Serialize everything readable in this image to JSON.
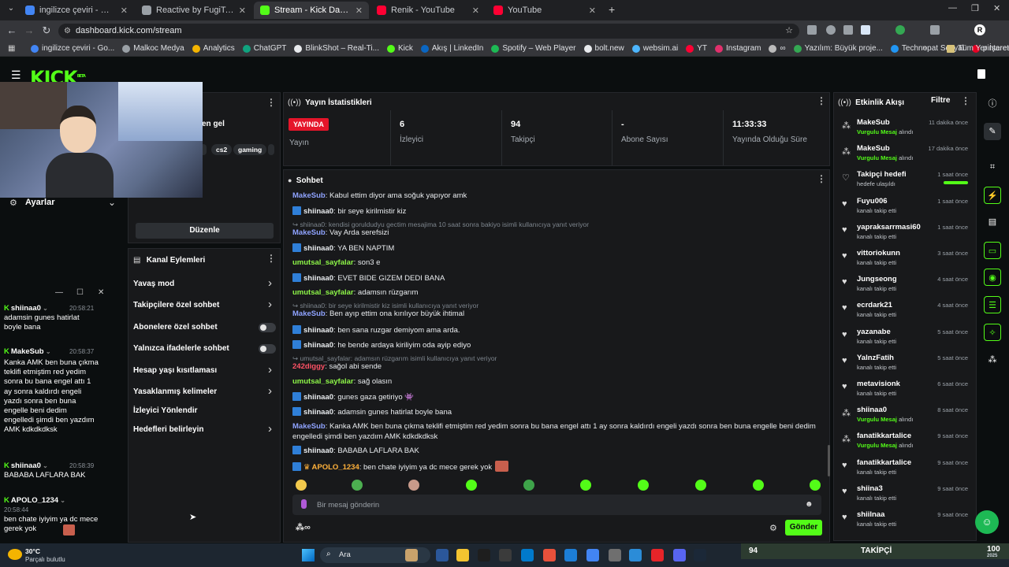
{
  "browser": {
    "tabs": [
      {
        "label": "ingilizce çeviri - Google'da Ara",
        "color": "#4285f4",
        "active": false
      },
      {
        "label": "Reactive by FugiTech",
        "color": "#9aa0a6",
        "active": false
      },
      {
        "label": "Stream - Kick Dashboard",
        "color": "#53fc18",
        "active": true
      },
      {
        "label": "Renik - YouTube",
        "color": "#ff0033",
        "active": false
      },
      {
        "label": "YouTube",
        "color": "#ff0033",
        "active": false
      }
    ],
    "url": "dashboard.kick.com/stream",
    "bookmarks": [
      "ingilizce çeviri - Go...",
      "Malkoc Medya",
      "Analytics",
      "ChatGPT",
      "BlinkShot – Real-Ti...",
      "Kick",
      "Akış | LinkedIn",
      "Spotify – Web Player",
      "bolt.new",
      "websim.ai",
      "YT",
      "Instagram",
      "∞",
      "Yazılım: Büyük proje...",
      "Technopat Sosyal",
      "pinterest"
    ],
    "all_bookmarks": "Tüm Yer İşaretleri"
  },
  "kick": {
    "logo": "KICK",
    "logo_sup": "BETA",
    "left_panel": {
      "partial_title_suffix": "en gel",
      "tags": [
        "cs2",
        "gaming"
      ],
      "settings_label": "Ayarlar",
      "edit_button": "Düzenle"
    },
    "stats": {
      "title": "Yayın İstatistikleri",
      "live_badge": "YAYINDA",
      "items": [
        {
          "value": "",
          "label": "Yayın"
        },
        {
          "value": "6",
          "label": "İzleyici"
        },
        {
          "value": "94",
          "label": "Takipçi"
        },
        {
          "value": "-",
          "label": "Abone Sayısı"
        },
        {
          "value": "11:33:33",
          "label": "Yayında Olduğu Süre"
        }
      ]
    },
    "channel_actions": {
      "title": "Kanal Eylemleri",
      "items": [
        {
          "label": "Yavaş mod",
          "control": "chevron"
        },
        {
          "label": "Takipçilere özel sohbet",
          "control": "chevron"
        },
        {
          "label": "Abonelere özel sohbet",
          "control": "toggle"
        },
        {
          "label": "Yalnızca ifadelerle sohbet",
          "control": "toggle"
        },
        {
          "label": "Hesap yaşı kısıtlaması",
          "control": "chevron"
        },
        {
          "label": "Yasaklanmış kelimeler",
          "control": "chevron"
        },
        {
          "label": "İzleyici Yönlendir",
          "control": "none"
        },
        {
          "label": "Hedefleri belirleyin",
          "control": "chevron"
        }
      ]
    },
    "chat": {
      "title": "Sohbet",
      "placeholder": "Bir mesaj gönderin",
      "send_label": "Gönder",
      "messages": [
        {
          "type": "msg",
          "user": "MakeSub",
          "ucolor": "u-blue",
          "badge": false,
          "text": "Kabul ettim diyor ama soğuk yapıyor amk"
        },
        {
          "type": "msg",
          "user": "shiinaa0",
          "ucolor": "u-white",
          "badge": true,
          "text": "bir seye kirilmistir kiz"
        },
        {
          "type": "reply",
          "text": "↪ shiinaa0: kendisi goruldudyu gectim mesajima 10 saat sonra bakiyo isimli kullanıcıya yanıt veriyor"
        },
        {
          "type": "msg",
          "user": "MakeSub",
          "ucolor": "u-blue",
          "badge": false,
          "text": "Vay Arda serefsizi"
        },
        {
          "type": "msg",
          "user": "shiinaa0",
          "ucolor": "u-white",
          "badge": true,
          "text": "YA BEN NAPTIM"
        },
        {
          "type": "msg",
          "user": "umutsal_sayfalar",
          "ucolor": "u-green",
          "badge": false,
          "text": "son3 e"
        },
        {
          "type": "msg",
          "user": "shiinaa0",
          "ucolor": "u-white",
          "badge": true,
          "text": "EVET BIDE GIZEM DEDI BANA"
        },
        {
          "type": "msg",
          "user": "umutsal_sayfalar",
          "ucolor": "u-green",
          "badge": false,
          "text": "adamsın rüzgarım"
        },
        {
          "type": "reply",
          "text": "↪ shiinaa0: bir seye kirilmistir kiz isimli kullanıcıya yanıt veriyor"
        },
        {
          "type": "msg",
          "user": "MakeSub",
          "ucolor": "u-blue",
          "badge": false,
          "text": "Ben ayıp ettim ona kırılıyor büyük ihtimal"
        },
        {
          "type": "msg",
          "user": "shiinaa0",
          "ucolor": "u-white",
          "badge": true,
          "text": "ben sana ruzgar demiyom ama arda."
        },
        {
          "type": "msg",
          "user": "shiinaa0",
          "ucolor": "u-white",
          "badge": true,
          "text": "he bende ardaya kiriliyim oda ayip ediyo"
        },
        {
          "type": "reply",
          "text": "↪ umutsal_sayfalar: adamsın rüzgarım isimli kullanıcıya yanıt veriyor"
        },
        {
          "type": "msg",
          "user": "242diggy",
          "ucolor": "u-red",
          "badge": false,
          "text": "sağol abi sende"
        },
        {
          "type": "msg",
          "user": "umutsal_sayfalar",
          "ucolor": "u-green",
          "badge": false,
          "text": "sağ olasın"
        },
        {
          "type": "msg",
          "user": "shiinaa0",
          "ucolor": "u-white",
          "badge": true,
          "text": "gunes gaza getiriyo 👾"
        },
        {
          "type": "msg",
          "user": "shiinaa0",
          "ucolor": "u-white",
          "badge": true,
          "text": "adamsin gunes hatirlat boyle bana"
        },
        {
          "type": "long",
          "user": "MakeSub",
          "ucolor": "u-blue",
          "badge": false,
          "text": "Kanka AMK ben buna çıkma teklifi etmiştim red yedim sonra bu bana engel attı 1 ay sonra kaldırdı engeli yazdı sonra ben buna engelle beni dedim engelledi şimdi ben yazdım AMK kdkdkdksk"
        },
        {
          "type": "msg",
          "user": "shiinaa0",
          "ucolor": "u-white",
          "badge": true,
          "text": "BABABA LAFLARA BAK"
        },
        {
          "type": "msg",
          "user": "APOLO_1234",
          "ucolor": "u-orange",
          "badge": true,
          "text": "ben chate iyiyim ya dc mece gerek yok"
        }
      ]
    },
    "activity": {
      "title": "Etkinlik Akışı",
      "filter": "Filtre",
      "items": [
        {
          "name": "MakeSub",
          "sub_hl": "Vurgulu Mesaj",
          "sub": " alındı",
          "time": "11 dakika önce",
          "icon": "chat"
        },
        {
          "name": "MakeSub",
          "sub_hl": "Vurgulu Mesaj",
          "sub": " alındı",
          "time": "17 dakika önce",
          "icon": "chat"
        },
        {
          "name": "Takipçi hedefi",
          "sub_hl": "",
          "sub": "hedefe ulaşıldı",
          "time": "1 saat önce",
          "icon": "heart-outline",
          "progress": 1.0
        },
        {
          "name": "Fuyu006",
          "sub_hl": "",
          "sub": "kanalı takip etti",
          "time": "1 saat önce",
          "icon": "heart"
        },
        {
          "name": "yapraksarrmasi60",
          "sub_hl": "",
          "sub": "kanalı takip etti",
          "time": "1 saat önce",
          "icon": "heart"
        },
        {
          "name": "vittoriokunn",
          "sub_hl": "",
          "sub": "kanalı takip etti",
          "time": "3 saat önce",
          "icon": "heart"
        },
        {
          "name": "Jungseong",
          "sub_hl": "",
          "sub": "kanalı takip etti",
          "time": "4 saat önce",
          "icon": "heart"
        },
        {
          "name": "ecrdark21",
          "sub_hl": "",
          "sub": "kanalı takip etti",
          "time": "4 saat önce",
          "icon": "heart"
        },
        {
          "name": "yazanabe",
          "sub_hl": "",
          "sub": "kanalı takip etti",
          "time": "5 saat önce",
          "icon": "heart"
        },
        {
          "name": "YalnzFatih",
          "sub_hl": "",
          "sub": "kanalı takip etti",
          "time": "5 saat önce",
          "icon": "heart"
        },
        {
          "name": "metavisionk",
          "sub_hl": "",
          "sub": "kanalı takip etti",
          "time": "6 saat önce",
          "icon": "heart"
        },
        {
          "name": "shiinaa0",
          "sub_hl": "Vurgulu Mesaj",
          "sub": " alındı",
          "time": "8 saat önce",
          "icon": "chat"
        },
        {
          "name": "fanatikkartalice",
          "sub_hl": "Vurgulu Mesaj",
          "sub": " alındı",
          "time": "9 saat önce",
          "icon": "chat"
        },
        {
          "name": "fanatikkartalice",
          "sub_hl": "",
          "sub": "kanalı takip etti",
          "time": "9 saat önce",
          "icon": "heart"
        },
        {
          "name": "shiina3",
          "sub_hl": "",
          "sub": "kanalı takip etti",
          "time": "9 saat önce",
          "icon": "heart"
        },
        {
          "name": "shiilnaa",
          "sub_hl": "",
          "sub": "kanalı takip etti",
          "time": "9 saat önce",
          "icon": "heart"
        }
      ]
    }
  },
  "popup_chat": [
    {
      "user": "shiinaa0",
      "time": "20:58:21",
      "text": "adamsin gunes hatirlat boyle bana"
    },
    {
      "user": "MakeSub",
      "time": "20:58:37",
      "text": "Kanka AMK ben buna çıkma teklifi etmiştim red yedim sonra bu bana engel attı 1 ay sonra kaldırdı engeli yazdı sonra ben buna engelle beni dedim engelledi şimdi ben yazdım AMK kdkdkdksk"
    },
    {
      "user": "shiinaa0",
      "time": "20:58:39",
      "text": "BABABA LAFLARA BAK"
    },
    {
      "user": "APOLO_1234",
      "time": "20:58:44",
      "text": "ben chate iyiyim ya dc mece gerek yok"
    }
  ],
  "taskbar": {
    "weather_temp": "30°C",
    "weather_text": "Parçalı bulutlu",
    "search": "Ara",
    "follow_left": "94",
    "follow_label": "TAKİPÇİ",
    "follow_right": "100",
    "follow_year": "2025"
  }
}
